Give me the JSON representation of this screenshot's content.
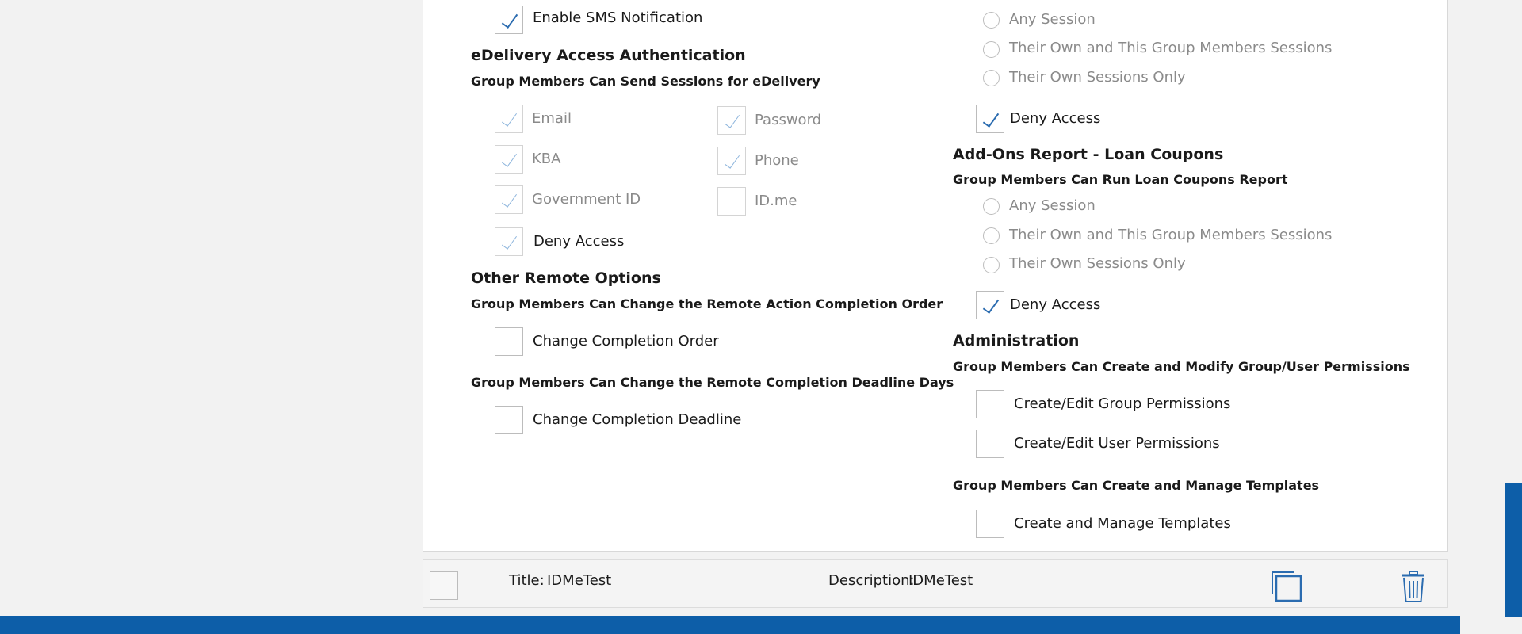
{
  "colors": {
    "accent": "#0d5ea8",
    "check": "#2b6cb0"
  },
  "left": {
    "sms": {
      "label": "Enable SMS Notification",
      "checked": true
    },
    "edelivery": {
      "title": "eDelivery Access Authentication",
      "subtitle": "Group Members Can Send Sessions for eDelivery",
      "options": [
        {
          "label": "Email",
          "checked": true
        },
        {
          "label": "Password",
          "checked": true
        },
        {
          "label": "KBA",
          "checked": true
        },
        {
          "label": "Phone",
          "checked": true
        },
        {
          "label": "Government ID",
          "checked": true
        },
        {
          "label": "ID.me",
          "checked": false
        }
      ],
      "deny_label": "Deny Access"
    },
    "remote": {
      "title": "Other Remote Options",
      "order_subtitle": "Group Members Can Change the Remote Action Completion Order",
      "order_label": "Change Completion Order",
      "deadline_subtitle": "Group Members Can Change the Remote Completion Deadline Days",
      "deadline_label": "Change Completion Deadline"
    }
  },
  "right": {
    "top_radios": [
      "Any Session",
      "Their Own and This Group Members Sessions",
      "Their Own Sessions Only"
    ],
    "top_deny_label": "Deny Access",
    "loan": {
      "title": "Add-Ons Report - Loan Coupons",
      "subtitle": "Group Members Can Run Loan Coupons Report",
      "radios": [
        "Any Session",
        "Their Own and This Group Members Sessions",
        "Their Own Sessions Only"
      ],
      "deny_label": "Deny Access"
    },
    "admin": {
      "title": "Administration",
      "perm_subtitle": "Group Members Can Create and Modify Group/User Permissions",
      "group_perm_label": "Create/Edit Group Permissions",
      "user_perm_label": "Create/Edit User Permissions",
      "templates_subtitle": "Group Members Can Create and Manage Templates",
      "templates_label": "Create and Manage Templates"
    }
  },
  "footer": {
    "title_label": "Title:",
    "title_value": "IDMeTest",
    "description_label": "Description:",
    "description_value": "IDMeTest",
    "copy_icon": "copy-icon",
    "trash_icon": "trash-icon"
  }
}
